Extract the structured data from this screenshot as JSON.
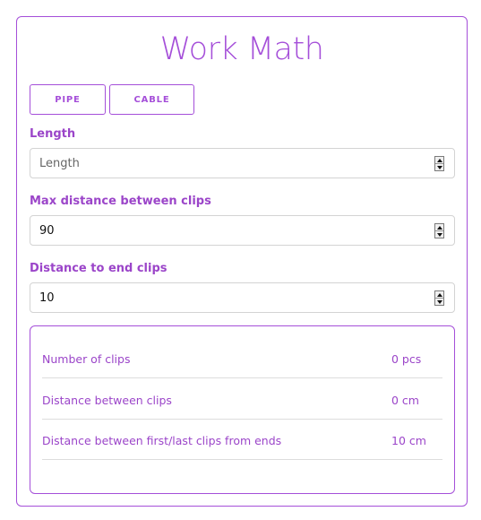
{
  "app": {
    "title": "Work Math"
  },
  "tabs": [
    {
      "label": "PIPE"
    },
    {
      "label": "CABLE"
    }
  ],
  "fields": {
    "length": {
      "label": "Length",
      "value": "",
      "placeholder": "Length"
    },
    "max_distance": {
      "label": "Max distance between clips",
      "value": "90",
      "placeholder": ""
    },
    "end_distance": {
      "label": "Distance to end clips",
      "value": "10",
      "placeholder": ""
    }
  },
  "results": [
    {
      "label": "Number of clips",
      "value": "0 pcs"
    },
    {
      "label": "Distance between clips",
      "value": "0 cm"
    },
    {
      "label": "Distance between first/last clips from ends",
      "value": "10 cm"
    }
  ],
  "colors": {
    "accent": "#a54fd9",
    "label": "#9b45c9",
    "border": "#d3d3d3"
  }
}
